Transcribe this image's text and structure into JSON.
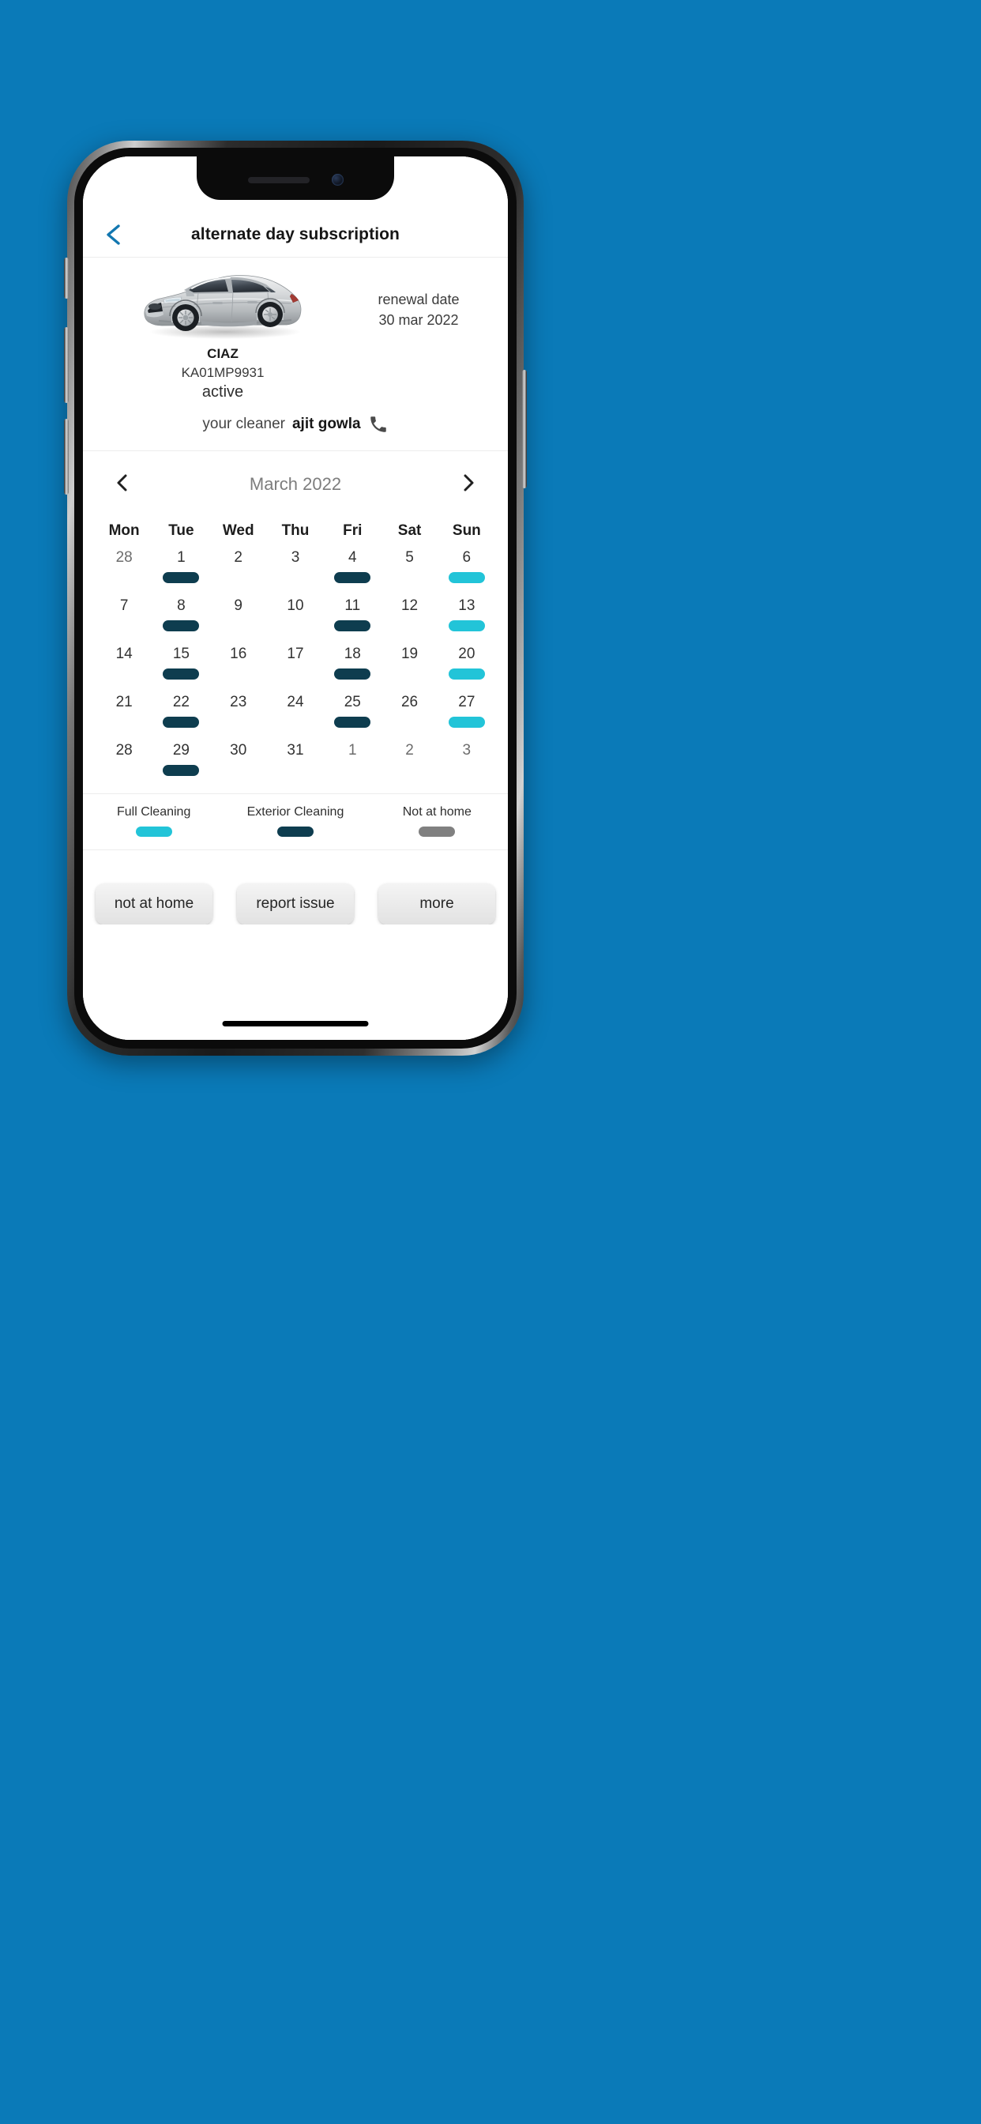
{
  "background_color": "#0a7ab8",
  "device": {
    "notch": {
      "speaker": "earpiece-speaker",
      "camera": "front-camera"
    },
    "home_indicator": "home-indicator"
  },
  "appbar": {
    "back_icon": "chevron-left-icon",
    "back_icon_color": "#1277b0",
    "title": "alternate day subscription"
  },
  "vehicle": {
    "image_alt": "silver-sedan-car",
    "name": "CIAZ",
    "plate": "KA01MP9931",
    "status": "active",
    "renewal_label": "renewal date",
    "renewal_date": "30 mar 2022",
    "cleaner_prefix": "your cleaner",
    "cleaner_name": "ajit gowla",
    "phone_icon": "phone-icon"
  },
  "calendar": {
    "prev_icon": "chevron-left-icon",
    "next_icon": "chevron-right-icon",
    "month": "March 2022",
    "weekdays": [
      "Mon",
      "Tue",
      "Wed",
      "Thu",
      "Fri",
      "Sat",
      "Sun"
    ],
    "colors": {
      "full_cleaning": "#22c4d8",
      "exterior_cleaning": "#0e3d4f",
      "not_at_home": "#808080",
      "none": "transparent"
    },
    "days": [
      {
        "num": "28",
        "out": true,
        "mark": "none"
      },
      {
        "num": "1",
        "out": false,
        "mark": "exterior_cleaning"
      },
      {
        "num": "2",
        "out": false,
        "mark": "none"
      },
      {
        "num": "3",
        "out": false,
        "mark": "none"
      },
      {
        "num": "4",
        "out": false,
        "mark": "exterior_cleaning"
      },
      {
        "num": "5",
        "out": false,
        "mark": "none"
      },
      {
        "num": "6",
        "out": false,
        "mark": "full_cleaning"
      },
      {
        "num": "7",
        "out": false,
        "mark": "none"
      },
      {
        "num": "8",
        "out": false,
        "mark": "exterior_cleaning"
      },
      {
        "num": "9",
        "out": false,
        "mark": "none"
      },
      {
        "num": "10",
        "out": false,
        "mark": "none"
      },
      {
        "num": "11",
        "out": false,
        "mark": "exterior_cleaning"
      },
      {
        "num": "12",
        "out": false,
        "mark": "none"
      },
      {
        "num": "13",
        "out": false,
        "mark": "full_cleaning"
      },
      {
        "num": "14",
        "out": false,
        "mark": "none"
      },
      {
        "num": "15",
        "out": false,
        "mark": "exterior_cleaning"
      },
      {
        "num": "16",
        "out": false,
        "mark": "none"
      },
      {
        "num": "17",
        "out": false,
        "mark": "none"
      },
      {
        "num": "18",
        "out": false,
        "mark": "exterior_cleaning"
      },
      {
        "num": "19",
        "out": false,
        "mark": "none"
      },
      {
        "num": "20",
        "out": false,
        "mark": "full_cleaning"
      },
      {
        "num": "21",
        "out": false,
        "mark": "none"
      },
      {
        "num": "22",
        "out": false,
        "mark": "exterior_cleaning"
      },
      {
        "num": "23",
        "out": false,
        "mark": "none"
      },
      {
        "num": "24",
        "out": false,
        "mark": "none"
      },
      {
        "num": "25",
        "out": false,
        "mark": "exterior_cleaning"
      },
      {
        "num": "26",
        "out": false,
        "mark": "none"
      },
      {
        "num": "27",
        "out": false,
        "mark": "full_cleaning"
      },
      {
        "num": "28",
        "out": false,
        "mark": "none"
      },
      {
        "num": "29",
        "out": false,
        "mark": "exterior_cleaning"
      },
      {
        "num": "30",
        "out": false,
        "mark": "none"
      },
      {
        "num": "31",
        "out": false,
        "mark": "none"
      },
      {
        "num": "1",
        "out": true,
        "mark": "none"
      },
      {
        "num": "2",
        "out": true,
        "mark": "none"
      },
      {
        "num": "3",
        "out": true,
        "mark": "none"
      }
    ]
  },
  "legend": [
    {
      "label": "Full Cleaning",
      "color": "#22c4d8"
    },
    {
      "label": "Exterior Cleaning",
      "color": "#0e3d4f"
    },
    {
      "label": "Not at home",
      "color": "#808080"
    }
  ],
  "actions": [
    {
      "label": "not at home"
    },
    {
      "label": "report issue"
    },
    {
      "label": "more"
    }
  ]
}
